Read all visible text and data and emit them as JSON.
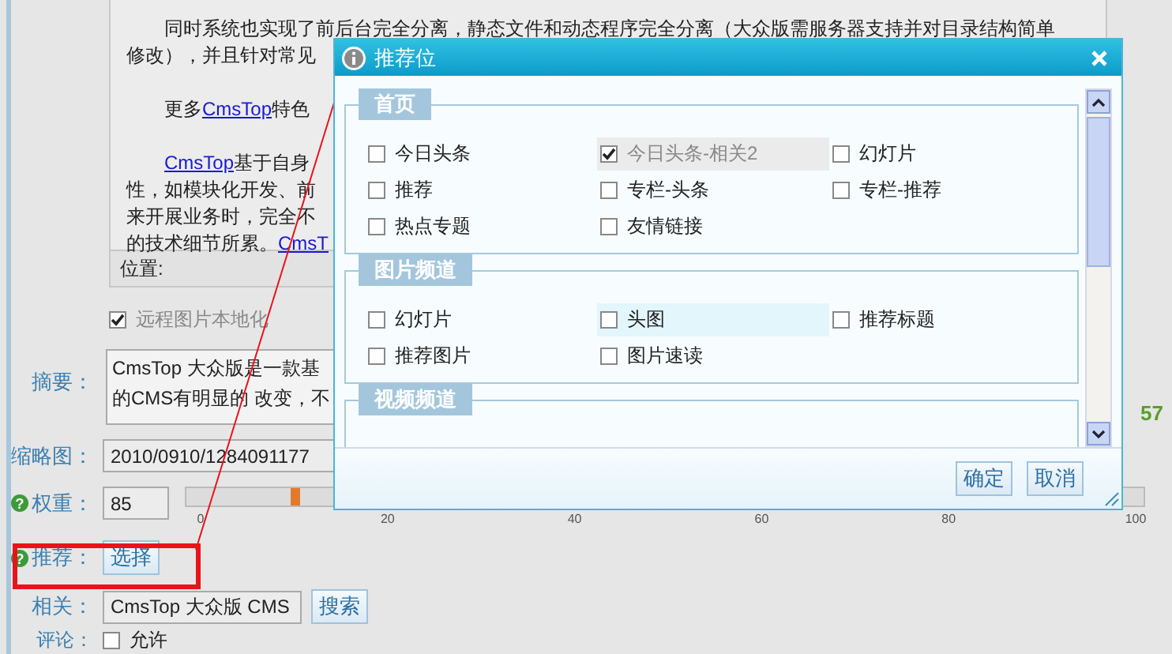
{
  "editor": {
    "paragraphs": [
      {
        "lines": [
          [
            {
              "kind": "text",
              "text": "同时系统也实现了前后台完全分离，静态文件和动态程序完全分离（大众版需服务器支持并对目录结构简单"
            }
          ],
          [
            {
              "kind": "text",
              "text": "修改），并且针对常见"
            }
          ]
        ]
      },
      {
        "lines": [
          [
            {
              "kind": "text",
              "text": "更多"
            },
            {
              "kind": "link",
              "text": "CmsTop"
            },
            {
              "kind": "text",
              "text": "特色"
            }
          ]
        ]
      },
      {
        "lines": [
          [
            {
              "kind": "link",
              "text": "CmsTop"
            },
            {
              "kind": "text",
              "text": "基于自身"
            }
          ],
          [
            {
              "kind": "text",
              "text": "性，如模块化开发、前"
            }
          ],
          [
            {
              "kind": "text",
              "text": "来开展业务时，完全不"
            }
          ],
          [
            {
              "kind": "text",
              "text": "的技术细节所累。"
            },
            {
              "kind": "link",
              "text": "CmsT"
            }
          ]
        ]
      }
    ],
    "position_label": "位置:"
  },
  "remote_image_option": {
    "label": "远程图片本地化",
    "checked": true
  },
  "form": {
    "summary": {
      "label": "摘要：",
      "lines": [
        "CmsTop 大众版是一款基",
        "的CMS有明显的 改变，不"
      ],
      "char_count": "57"
    },
    "thumbnail": {
      "label": "缩略图：",
      "value": "2010/0910/1284091177"
    },
    "weight": {
      "help_mark": "?",
      "label": "权重：",
      "value": "85",
      "slider": {
        "level": 0.1,
        "ticks": [
          "0",
          "20",
          "40",
          "60",
          "80",
          "100"
        ]
      }
    },
    "recommend": {
      "help_mark": "?",
      "label": "推荐：",
      "button": "选择"
    },
    "related": {
      "label": "相关：",
      "value": "CmsTop 大众版  CMS",
      "button": "搜索"
    },
    "comments": {
      "label": "评论：",
      "option": {
        "label": "允许",
        "checked": false
      }
    }
  },
  "dialog": {
    "title": "推荐位",
    "sections": [
      {
        "title": "首页",
        "items": [
          {
            "label": "今日头条",
            "checked": false,
            "disabled": false,
            "hovered": false
          },
          {
            "label": "今日头条-相关2",
            "checked": true,
            "disabled": true,
            "hovered": false
          },
          {
            "label": "幻灯片",
            "checked": false,
            "disabled": false,
            "hovered": false
          },
          {
            "label": "推荐",
            "checked": false,
            "disabled": false,
            "hovered": false
          },
          {
            "label": "专栏-头条",
            "checked": false,
            "disabled": false,
            "hovered": false
          },
          {
            "label": "专栏-推荐",
            "checked": false,
            "disabled": false,
            "hovered": false
          },
          {
            "label": "热点专题",
            "checked": false,
            "disabled": false,
            "hovered": false
          },
          {
            "label": "友情链接",
            "checked": false,
            "disabled": false,
            "hovered": false
          }
        ]
      },
      {
        "title": "图片频道",
        "items": [
          {
            "label": "幻灯片",
            "checked": false,
            "disabled": false,
            "hovered": false
          },
          {
            "label": "头图",
            "checked": false,
            "disabled": false,
            "hovered": true
          },
          {
            "label": "推荐标题",
            "checked": false,
            "disabled": false,
            "hovered": false
          },
          {
            "label": "推荐图片",
            "checked": false,
            "disabled": false,
            "hovered": false
          },
          {
            "label": "图片速读",
            "checked": false,
            "disabled": false,
            "hovered": false
          }
        ]
      },
      {
        "title": "视频频道"
      }
    ],
    "buttons": [
      "确定",
      "取消"
    ]
  }
}
